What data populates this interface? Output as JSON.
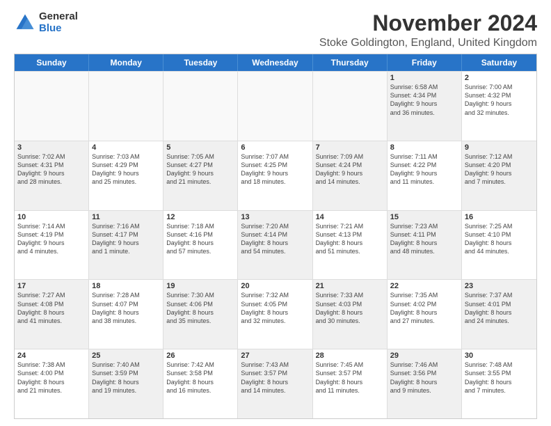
{
  "logo": {
    "general": "General",
    "blue": "Blue"
  },
  "title": "November 2024",
  "subtitle": "Stoke Goldington, England, United Kingdom",
  "days": [
    "Sunday",
    "Monday",
    "Tuesday",
    "Wednesday",
    "Thursday",
    "Friday",
    "Saturday"
  ],
  "weeks": [
    [
      {
        "day": "",
        "text": "",
        "empty": true
      },
      {
        "day": "",
        "text": "",
        "empty": true
      },
      {
        "day": "",
        "text": "",
        "empty": true
      },
      {
        "day": "",
        "text": "",
        "empty": true
      },
      {
        "day": "",
        "text": "",
        "empty": true
      },
      {
        "day": "1",
        "text": "Sunrise: 6:58 AM\nSunset: 4:34 PM\nDaylight: 9 hours\nand 36 minutes.",
        "empty": false,
        "shaded": true
      },
      {
        "day": "2",
        "text": "Sunrise: 7:00 AM\nSunset: 4:32 PM\nDaylight: 9 hours\nand 32 minutes.",
        "empty": false,
        "shaded": false
      }
    ],
    [
      {
        "day": "3",
        "text": "Sunrise: 7:02 AM\nSunset: 4:31 PM\nDaylight: 9 hours\nand 28 minutes.",
        "empty": false,
        "shaded": true
      },
      {
        "day": "4",
        "text": "Sunrise: 7:03 AM\nSunset: 4:29 PM\nDaylight: 9 hours\nand 25 minutes.",
        "empty": false,
        "shaded": false
      },
      {
        "day": "5",
        "text": "Sunrise: 7:05 AM\nSunset: 4:27 PM\nDaylight: 9 hours\nand 21 minutes.",
        "empty": false,
        "shaded": true
      },
      {
        "day": "6",
        "text": "Sunrise: 7:07 AM\nSunset: 4:25 PM\nDaylight: 9 hours\nand 18 minutes.",
        "empty": false,
        "shaded": false
      },
      {
        "day": "7",
        "text": "Sunrise: 7:09 AM\nSunset: 4:24 PM\nDaylight: 9 hours\nand 14 minutes.",
        "empty": false,
        "shaded": true
      },
      {
        "day": "8",
        "text": "Sunrise: 7:11 AM\nSunset: 4:22 PM\nDaylight: 9 hours\nand 11 minutes.",
        "empty": false,
        "shaded": false
      },
      {
        "day": "9",
        "text": "Sunrise: 7:12 AM\nSunset: 4:20 PM\nDaylight: 9 hours\nand 7 minutes.",
        "empty": false,
        "shaded": true
      }
    ],
    [
      {
        "day": "10",
        "text": "Sunrise: 7:14 AM\nSunset: 4:19 PM\nDaylight: 9 hours\nand 4 minutes.",
        "empty": false,
        "shaded": false
      },
      {
        "day": "11",
        "text": "Sunrise: 7:16 AM\nSunset: 4:17 PM\nDaylight: 9 hours\nand 1 minute.",
        "empty": false,
        "shaded": true
      },
      {
        "day": "12",
        "text": "Sunrise: 7:18 AM\nSunset: 4:16 PM\nDaylight: 8 hours\nand 57 minutes.",
        "empty": false,
        "shaded": false
      },
      {
        "day": "13",
        "text": "Sunrise: 7:20 AM\nSunset: 4:14 PM\nDaylight: 8 hours\nand 54 minutes.",
        "empty": false,
        "shaded": true
      },
      {
        "day": "14",
        "text": "Sunrise: 7:21 AM\nSunset: 4:13 PM\nDaylight: 8 hours\nand 51 minutes.",
        "empty": false,
        "shaded": false
      },
      {
        "day": "15",
        "text": "Sunrise: 7:23 AM\nSunset: 4:11 PM\nDaylight: 8 hours\nand 48 minutes.",
        "empty": false,
        "shaded": true
      },
      {
        "day": "16",
        "text": "Sunrise: 7:25 AM\nSunset: 4:10 PM\nDaylight: 8 hours\nand 44 minutes.",
        "empty": false,
        "shaded": false
      }
    ],
    [
      {
        "day": "17",
        "text": "Sunrise: 7:27 AM\nSunset: 4:08 PM\nDaylight: 8 hours\nand 41 minutes.",
        "empty": false,
        "shaded": true
      },
      {
        "day": "18",
        "text": "Sunrise: 7:28 AM\nSunset: 4:07 PM\nDaylight: 8 hours\nand 38 minutes.",
        "empty": false,
        "shaded": false
      },
      {
        "day": "19",
        "text": "Sunrise: 7:30 AM\nSunset: 4:06 PM\nDaylight: 8 hours\nand 35 minutes.",
        "empty": false,
        "shaded": true
      },
      {
        "day": "20",
        "text": "Sunrise: 7:32 AM\nSunset: 4:05 PM\nDaylight: 8 hours\nand 32 minutes.",
        "empty": false,
        "shaded": false
      },
      {
        "day": "21",
        "text": "Sunrise: 7:33 AM\nSunset: 4:03 PM\nDaylight: 8 hours\nand 30 minutes.",
        "empty": false,
        "shaded": true
      },
      {
        "day": "22",
        "text": "Sunrise: 7:35 AM\nSunset: 4:02 PM\nDaylight: 8 hours\nand 27 minutes.",
        "empty": false,
        "shaded": false
      },
      {
        "day": "23",
        "text": "Sunrise: 7:37 AM\nSunset: 4:01 PM\nDaylight: 8 hours\nand 24 minutes.",
        "empty": false,
        "shaded": true
      }
    ],
    [
      {
        "day": "24",
        "text": "Sunrise: 7:38 AM\nSunset: 4:00 PM\nDaylight: 8 hours\nand 21 minutes.",
        "empty": false,
        "shaded": false
      },
      {
        "day": "25",
        "text": "Sunrise: 7:40 AM\nSunset: 3:59 PM\nDaylight: 8 hours\nand 19 minutes.",
        "empty": false,
        "shaded": true
      },
      {
        "day": "26",
        "text": "Sunrise: 7:42 AM\nSunset: 3:58 PM\nDaylight: 8 hours\nand 16 minutes.",
        "empty": false,
        "shaded": false
      },
      {
        "day": "27",
        "text": "Sunrise: 7:43 AM\nSunset: 3:57 PM\nDaylight: 8 hours\nand 14 minutes.",
        "empty": false,
        "shaded": true
      },
      {
        "day": "28",
        "text": "Sunrise: 7:45 AM\nSunset: 3:57 PM\nDaylight: 8 hours\nand 11 minutes.",
        "empty": false,
        "shaded": false
      },
      {
        "day": "29",
        "text": "Sunrise: 7:46 AM\nSunset: 3:56 PM\nDaylight: 8 hours\nand 9 minutes.",
        "empty": false,
        "shaded": true
      },
      {
        "day": "30",
        "text": "Sunrise: 7:48 AM\nSunset: 3:55 PM\nDaylight: 8 hours\nand 7 minutes.",
        "empty": false,
        "shaded": false
      }
    ]
  ]
}
